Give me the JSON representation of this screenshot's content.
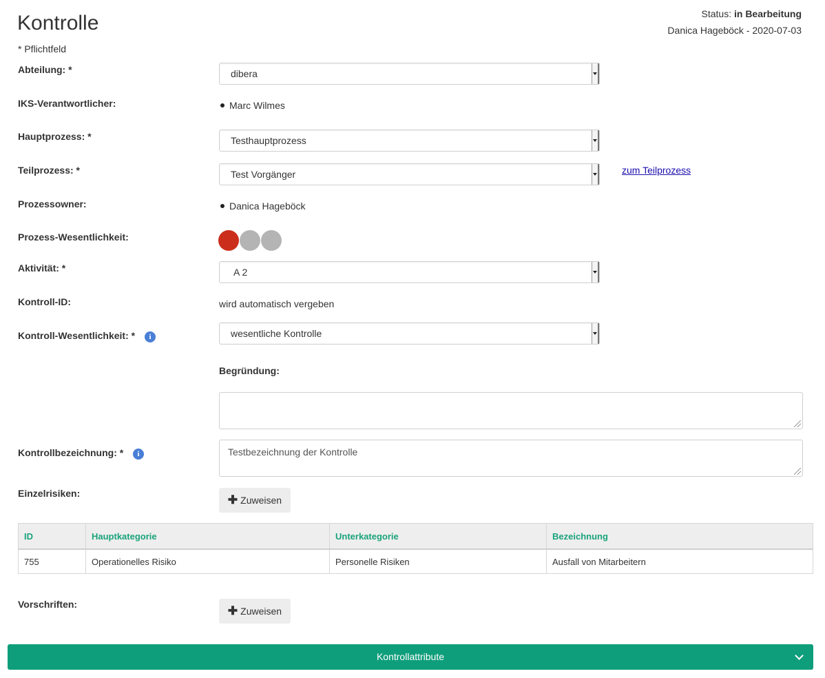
{
  "header": {
    "title": "Kontrolle",
    "status_label": "Status:",
    "status_value": "in Bearbeitung",
    "author_date": "Danica Hageböck - 2020-07-03",
    "required_note": "* Pflichtfeld"
  },
  "form": {
    "abteilung": {
      "label": "Abteilung: *",
      "value": "dibera"
    },
    "iks": {
      "label": "IKS-Verantwortlicher:",
      "value": "Marc Wilmes"
    },
    "hauptprozess": {
      "label": "Hauptprozess: *",
      "value": "Testhauptprozess"
    },
    "teilprozess": {
      "label": "Teilprozess: *",
      "value": "Test Vorgänger",
      "link": "zum Teilprozess"
    },
    "prozessowner": {
      "label": "Prozessowner:",
      "value": "Danica Hageböck"
    },
    "prozess_wesentlichkeit": {
      "label": "Prozess-Wesentlichkeit:",
      "level": 1,
      "max": 3,
      "colors": {
        "active": "#cc2e1c",
        "inactive": "#b4b4b4"
      }
    },
    "aktivitaet": {
      "label": "Aktivität: *",
      "value": "A 2"
    },
    "kontroll_id": {
      "label": "Kontroll-ID:",
      "value": "wird automatisch vergeben"
    },
    "kontroll_wesentlichkeit": {
      "label": "Kontroll-Wesentlichkeit: *",
      "value": "wesentliche Kontrolle",
      "icon": "info-icon"
    },
    "begruendung": {
      "label": "Begründung:",
      "value": ""
    },
    "kontrollbezeichnung": {
      "label": "Kontrollbezeichnung: *",
      "value": "Testbezeichnung der Kontrolle",
      "icon": "info-icon"
    },
    "einzelrisiken": {
      "label": "Einzelrisiken:",
      "button": "Zuweisen"
    },
    "vorschriften": {
      "label": "Vorschriften:",
      "button": "Zuweisen"
    }
  },
  "risks_table": {
    "headers": [
      "ID",
      "Hauptkategorie",
      "Unterkategorie",
      "Bezeichnung"
    ],
    "rows": [
      [
        "755",
        "Operationelles Risiko",
        "Personelle Risiken",
        "Ausfall von Mitarbeitern"
      ]
    ]
  },
  "collapse": {
    "label": "Kontrollattribute",
    "icon": "chevron-down-icon"
  },
  "colors": {
    "accent": "#0f9e7b",
    "table_header_text": "#1aa37a",
    "info": "#4a7fd6"
  }
}
